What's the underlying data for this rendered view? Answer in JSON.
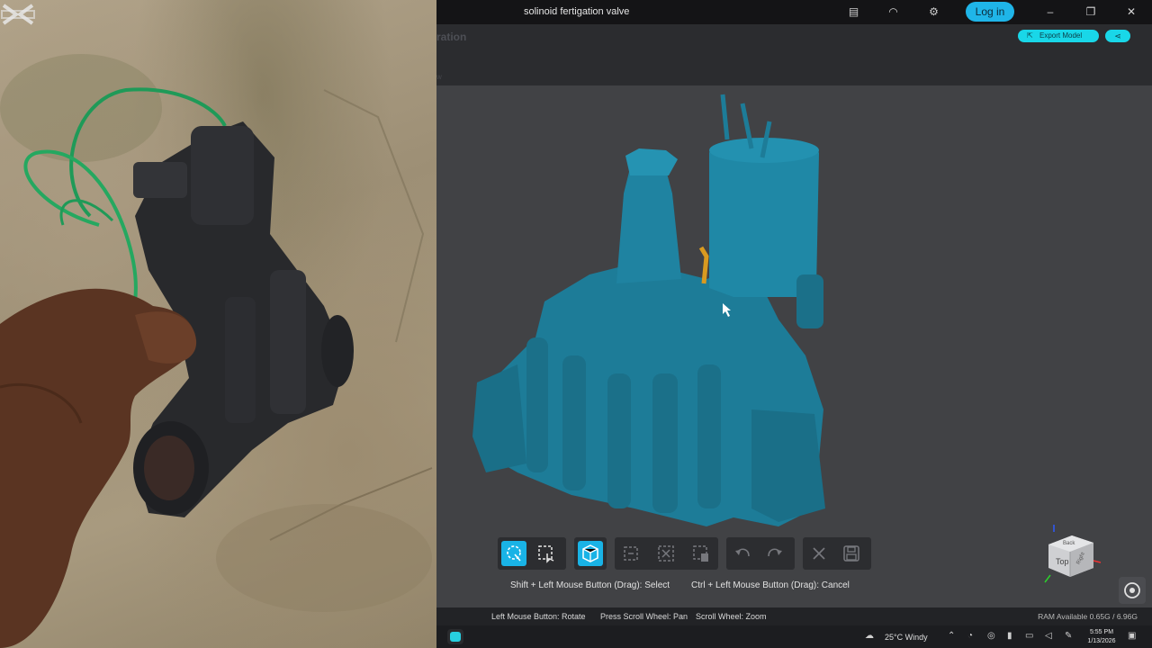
{
  "window": {
    "title": "solinoid fertigation valve",
    "login_label": "Log in",
    "export_label": "Export Model",
    "ghost_title": "ration",
    "ghost_sub": "w"
  },
  "hints": {
    "select": "Shift + Left Mouse Button (Drag): Select",
    "cancel": "Ctrl + Left Mouse Button (Drag): Cancel"
  },
  "status": {
    "rotate": "Left Mouse Button: Rotate",
    "pan": "Press Scroll Wheel: Pan",
    "zoom": "Scroll Wheel: Zoom",
    "ram": "RAM Available 0.65G / 6.96G"
  },
  "navcube": {
    "top_label": "Top",
    "right_label": "Right",
    "back_label": "Back"
  },
  "taskbar": {
    "weather": "25°C  Windy",
    "time": "5:55 PM",
    "date": "1/13/2026"
  },
  "colors": {
    "accent": "#19b3e6",
    "model": "#1d7c98",
    "login": "#1fb5e8"
  },
  "icons": {
    "tools": [
      "lasso-select-icon",
      "rect-select-icon",
      "cube-view-icon",
      "crop-icon",
      "delete-selection-icon",
      "clear-icon",
      "undo-icon",
      "redo-icon",
      "close-icon",
      "save-icon"
    ],
    "titlebar": [
      "notes-icon",
      "headset-icon",
      "settings-icon"
    ]
  }
}
